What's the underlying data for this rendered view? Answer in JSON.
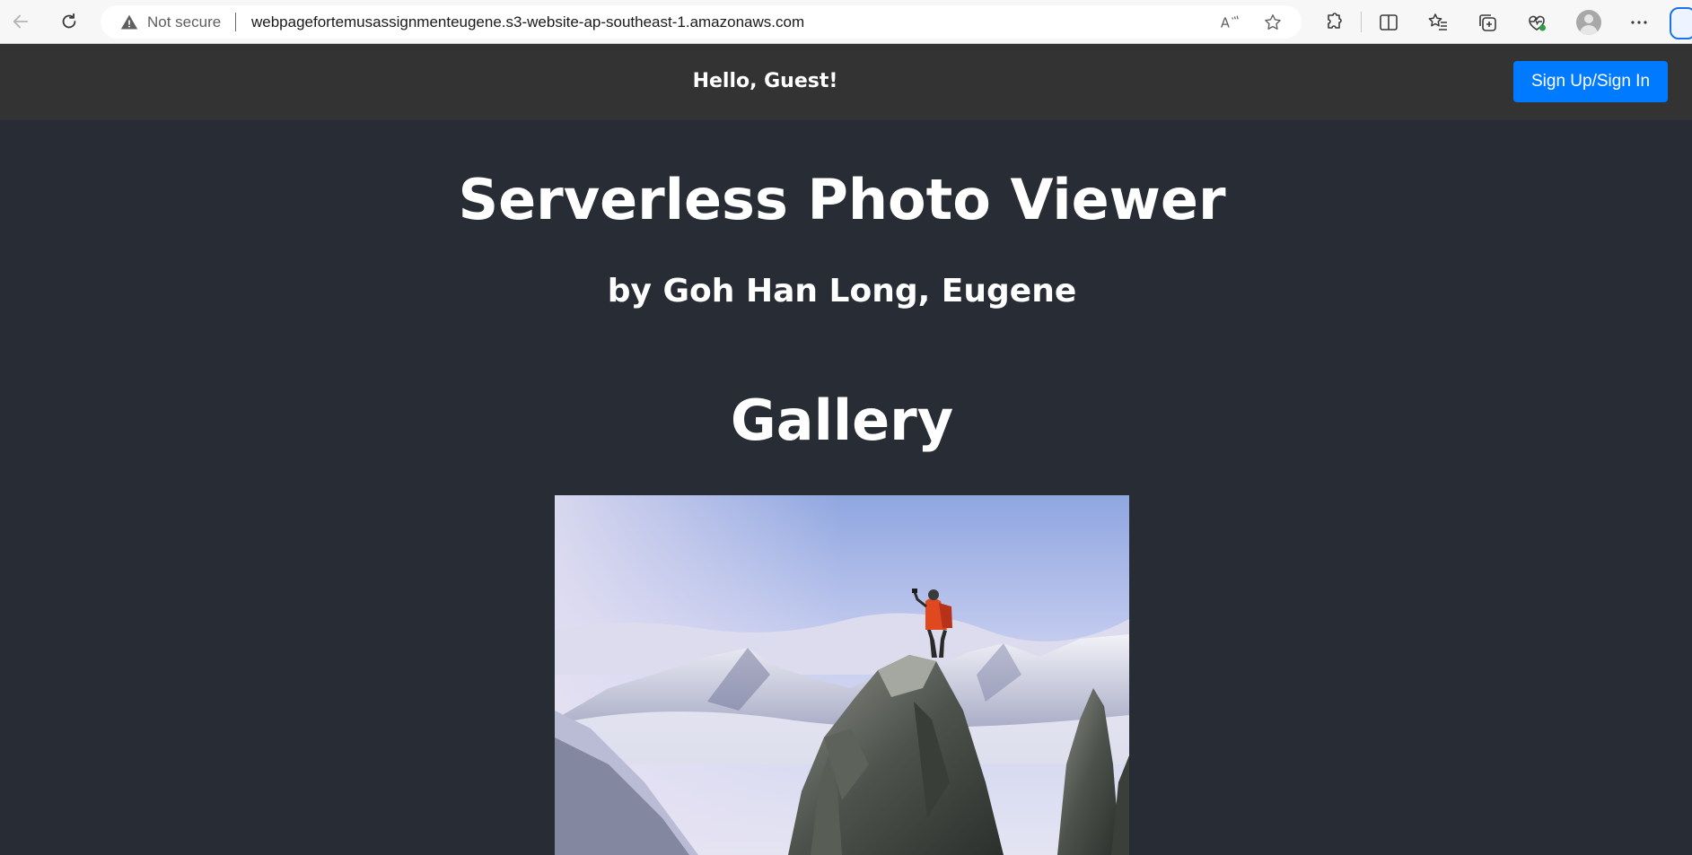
{
  "browser": {
    "security_label": "Not secure",
    "url": "webpagefortemusassignmenteugene.s3-website-ap-southeast-1.amazonaws.com",
    "icons": [
      "back-arrow-icon",
      "reload-icon",
      "warning-icon",
      "read-aloud-icon",
      "favorite-star-icon",
      "extensions-icon",
      "split-screen-icon",
      "favorites-icon",
      "collections-icon",
      "browser-essentials-icon",
      "profile-avatar",
      "more-icon"
    ]
  },
  "header": {
    "greeting": "Hello, Guest!",
    "signin_label": "Sign Up/Sign In",
    "background_color": "#333333",
    "button_color": "#007bff"
  },
  "main": {
    "title": "Serverless Photo Viewer",
    "byline": "by Goh Han Long, Eugene",
    "gallery_heading": "Gallery",
    "background_color": "#282c34",
    "photos": [
      {
        "subject": "hiker standing on a rocky mountain peak above clouds"
      }
    ]
  }
}
